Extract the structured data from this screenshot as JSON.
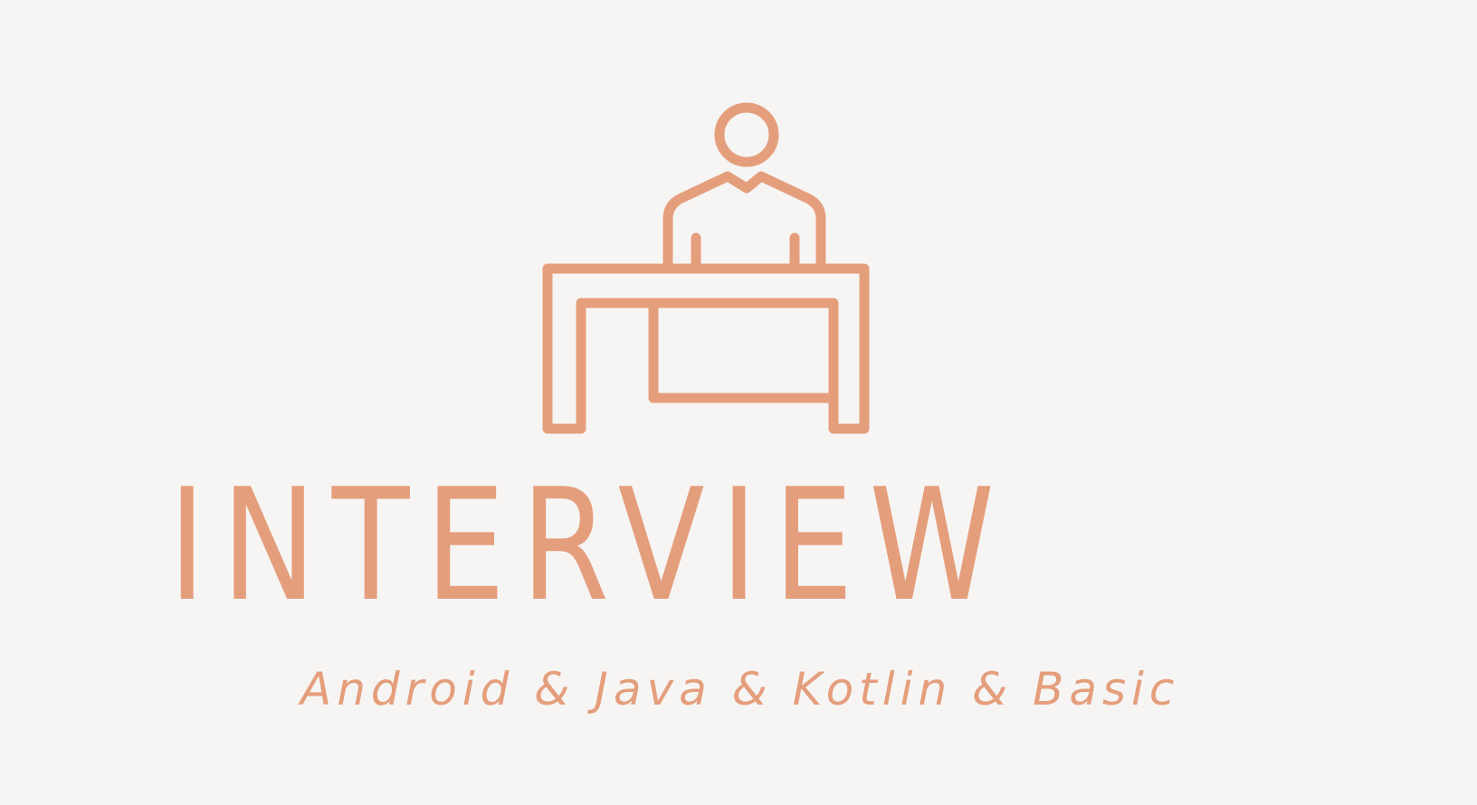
{
  "logo": {
    "icon": "interview-desk-person-icon",
    "title": "INTERVIEW",
    "subtitle": "Android & Java & Kotlin & Basic",
    "color": "#e59e7c",
    "background": "#f7f5f4"
  }
}
